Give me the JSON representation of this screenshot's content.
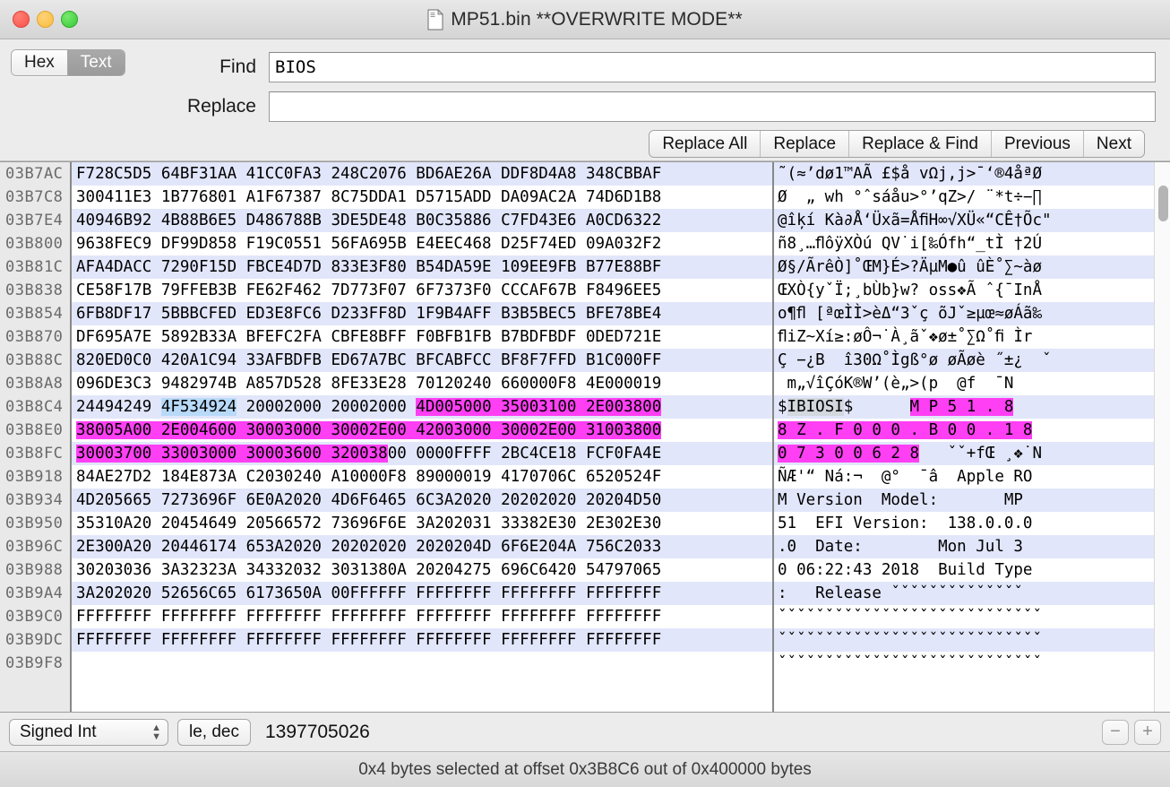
{
  "window": {
    "title": "MP51.bin **OVERWRITE MODE**",
    "doc_icon": "document-icon",
    "close": "close-button",
    "minimize": "minimize-button",
    "zoom": "zoom-button"
  },
  "findbar": {
    "mode_hex": "Hex",
    "mode_text": "Text",
    "active_mode": "Text",
    "find_label": "Find",
    "find_value": "BIOS",
    "find_placeholder": "",
    "replace_label": "Replace",
    "replace_value": "",
    "replace_placeholder": "",
    "buttons": [
      "Replace All",
      "Replace",
      "Replace & Find",
      "Previous",
      "Next"
    ]
  },
  "inspector": {
    "type": "Signed Int",
    "format": "le, dec",
    "value": "1397705026",
    "zoom_out": "−",
    "zoom_in": "+"
  },
  "status": {
    "text": "0x4 bytes selected at offset 0x3B8C6 out of 0x400000 bytes"
  },
  "hexview": {
    "rows": [
      {
        "offset": "03B7AC",
        "hex": [
          {
            "t": "F728C5D5 64BF31AA 41CC0FA3 248C2076 BD6AE26A DDF8D4A8 348CBBAF",
            "c": ""
          }
        ],
        "text": [
          {
            "t": "˜(≈’dø1™AÃ £$å vΩj,j>¯‘®4åªØ",
            "c": ""
          }
        ]
      },
      {
        "offset": "03B7C8",
        "hex": [
          {
            "t": "300411E3 1B776801 A1F67387 8C75DDA1 D5715ADD DA09AC2A 74D6D1B8",
            "c": ""
          }
        ],
        "text": [
          {
            "t": "Ø  „ wh °ˆsáåu>°’qZ>/ ¨*t÷−∏",
            "c": ""
          }
        ]
      },
      {
        "offset": "03B7E4",
        "hex": [
          {
            "t": "40946B92 4B88B6E5 D486788B 3DE5DE48 B0C35886 C7FD43E6 A0CD6322",
            "c": ""
          }
        ],
        "text": [
          {
            "t": "@îķí Kà∂Å‘Üxã=ÅﬁH∞√XÜ«“CÊ†Õc\"",
            "c": ""
          }
        ]
      },
      {
        "offset": "03B800",
        "hex": [
          {
            "t": "9638FEC9 DF99D858 F19C0551 56FA695B E4EEC468 D25F74ED 09A032F2",
            "c": ""
          }
        ],
        "text": [
          {
            "t": "ñ8¸…ﬂôÿXÒú QV˙i[‰Ófh“_tÌ †2Ú",
            "c": ""
          }
        ]
      },
      {
        "offset": "03B81C",
        "hex": [
          {
            "t": "AFA4DACC 7290F15D FBCE4D7D 833E3F80 B54DA59E 109EE9FB B77E88BF",
            "c": ""
          }
        ],
        "text": [
          {
            "t": "Ø§/ÃrêÒ]˚ŒM}É>?ÄµM●û ûÈ˚∑~àø",
            "c": ""
          }
        ]
      },
      {
        "offset": "03B838",
        "hex": [
          {
            "t": "CE58F17B 79FFEB3B FE62F462 7D773F07 6F7373F0 CCCAF67B F8496EE5",
            "c": ""
          }
        ],
        "text": [
          {
            "t": "ŒXÒ{yˇÏ;¸bÙb}w? oss❖Ã ˆ{¯InÅ",
            "c": ""
          }
        ]
      },
      {
        "offset": "03B854",
        "hex": [
          {
            "t": "6FB8DF17 5BBBCFED ED3E8FC6 D233FF8D 1F9B4AFF B3B5BEC5 BFE78BE4",
            "c": ""
          }
        ],
        "text": [
          {
            "t": "o¶ﬂ [ªœÌÌ>èΔ“3ˇç õJˇ≥µœ≈øÁã‰",
            "c": ""
          }
        ]
      },
      {
        "offset": "03B870",
        "hex": [
          {
            "t": "DF695A7E 5892B33A BFEFC2FA CBFE8BFF F0BFB1FB B7BDFBDF 0DED721E",
            "c": ""
          }
        ],
        "text": [
          {
            "t": "ﬂiZ~Xí≥:øÔ¬˙À¸ãˇ❖ø±˚∑Ω˚ﬁ Ìr",
            "c": ""
          }
        ]
      },
      {
        "offset": "03B88C",
        "hex": [
          {
            "t": "820ED0C0 420A1C94 33AFBDFB ED67A7BC BFCABFCC BF8F7FFD B1C000FF",
            "c": ""
          }
        ],
        "text": [
          {
            "t": "Ç −¿B  î30Ω˚Ìgß°ø øÃøè ˝±¿  ˇ",
            "c": ""
          }
        ]
      },
      {
        "offset": "03B8A8",
        "hex": [
          {
            "t": "096DE3C3 9482974B A857D528 8FE33E28 70120240 660000F8 4E000019",
            "c": ""
          }
        ],
        "text": [
          {
            "t": " m„√îÇóK®W’(è„>(p  @f  ¯N",
            "c": ""
          }
        ]
      },
      {
        "offset": "03B8C4",
        "hex": [
          {
            "t": "24494249 ",
            "c": ""
          },
          {
            "t": "4F534924",
            "c": "sel"
          },
          {
            "t": " 20002000 20002000 ",
            "c": ""
          },
          {
            "t": "4D005000 35003100 2E003800",
            "c": "mag"
          }
        ],
        "text": [
          {
            "t": "$",
            "c": ""
          },
          {
            "t": "IBIOSI",
            "c": "gsel"
          },
          {
            "t": "$      ",
            "c": ""
          },
          {
            "t": "M P 5 1 . 8",
            "c": "mag"
          }
        ]
      },
      {
        "offset": "03B8E0",
        "hex": [
          {
            "t": "38005A00 2E004600 30003000 30002E00 42003000 30002E00 31003800",
            "c": "mag"
          }
        ],
        "text": [
          {
            "t": "8 Z . F 0 0 0 . B 0 0 . 1 8",
            "c": "mag"
          }
        ]
      },
      {
        "offset": "03B8FC",
        "hex": [
          {
            "t": "30003700 33003000 30003600 320038",
            "c": "mag"
          },
          {
            "t": "00 0000FFFF 2BC4CE18 FCF0FA4E",
            "c": ""
          }
        ],
        "text": [
          {
            "t": "0 7 3 0 0 6 2 8",
            "c": "mag"
          },
          {
            "t": "   ˇˇ+fŒ ¸❖˙N",
            "c": ""
          }
        ]
      },
      {
        "offset": "03B918",
        "hex": [
          {
            "t": "84AE27D2 184E873A C2030240 A10000F8 89000019 4170706C 6520524F",
            "c": ""
          }
        ],
        "text": [
          {
            "t": "ÑÆ'“ Ná:¬  @°  ¯â  Apple RO",
            "c": ""
          }
        ]
      },
      {
        "offset": "03B934",
        "hex": [
          {
            "t": "4D205665 7273696F 6E0A2020 4D6F6465 6C3A2020 20202020 20204D50",
            "c": ""
          }
        ],
        "text": [
          {
            "t": "M Version  Model:       MP",
            "c": ""
          }
        ]
      },
      {
        "offset": "03B950",
        "hex": [
          {
            "t": "35310A20 20454649 20566572 73696F6E 3A202031 33382E30 2E302E30",
            "c": ""
          }
        ],
        "text": [
          {
            "t": "51  EFI Version:  138.0.0.0",
            "c": ""
          }
        ]
      },
      {
        "offset": "03B96C",
        "hex": [
          {
            "t": "2E300A20 20446174 653A2020 20202020 2020204D 6F6E204A 756C2033",
            "c": ""
          }
        ],
        "text": [
          {
            "t": ".0  Date:        Mon Jul 3",
            "c": ""
          }
        ]
      },
      {
        "offset": "03B988",
        "hex": [
          {
            "t": "30203036 3A32323A 34332032 3031380A 20204275 696C6420 54797065",
            "c": ""
          }
        ],
        "text": [
          {
            "t": "0 06:22:43 2018  Build Type",
            "c": ""
          }
        ]
      },
      {
        "offset": "03B9A4",
        "hex": [
          {
            "t": "3A202020 52656C65 6173650A 00FFFFFF FFFFFFFF FFFFFFFF FFFFFFFF",
            "c": ""
          }
        ],
        "text": [
          {
            "t": ":   Release ˇˇˇˇˇˇˇˇˇˇˇˇˇˇ",
            "c": ""
          }
        ]
      },
      {
        "offset": "03B9C0",
        "hex": [
          {
            "t": "FFFFFFFF FFFFFFFF FFFFFFFF FFFFFFFF FFFFFFFF FFFFFFFF FFFFFFFF",
            "c": ""
          }
        ],
        "text": [
          {
            "t": "ˇˇˇˇˇˇˇˇˇˇˇˇˇˇˇˇˇˇˇˇˇˇˇˇˇˇˇˇ",
            "c": ""
          }
        ]
      },
      {
        "offset": "03B9DC",
        "hex": [
          {
            "t": "FFFFFFFF FFFFFFFF FFFFFFFF FFFFFFFF FFFFFFFF FFFFFFFF FFFFFFFF",
            "c": ""
          }
        ],
        "text": [
          {
            "t": "ˇˇˇˇˇˇˇˇˇˇˇˇˇˇˇˇˇˇˇˇˇˇˇˇˇˇˇˇ",
            "c": ""
          }
        ]
      },
      {
        "offset": "03B9F8",
        "hex": [
          {
            "t": "",
            "c": ""
          }
        ],
        "text": [
          {
            "t": "ˇˇˇˇˇˇˇˇˇˇˇˇˇˇˇˇˇˇˇˇˇˇˇˇˇˇˇˇ",
            "c": ""
          }
        ]
      }
    ]
  },
  "colors": {
    "selection_blue": "#b8daf8",
    "match_magenta": "#ff3ff4",
    "alt_row": "#e2e6fa",
    "gutter": "#e9e9e9",
    "chrome": "#ececec"
  }
}
